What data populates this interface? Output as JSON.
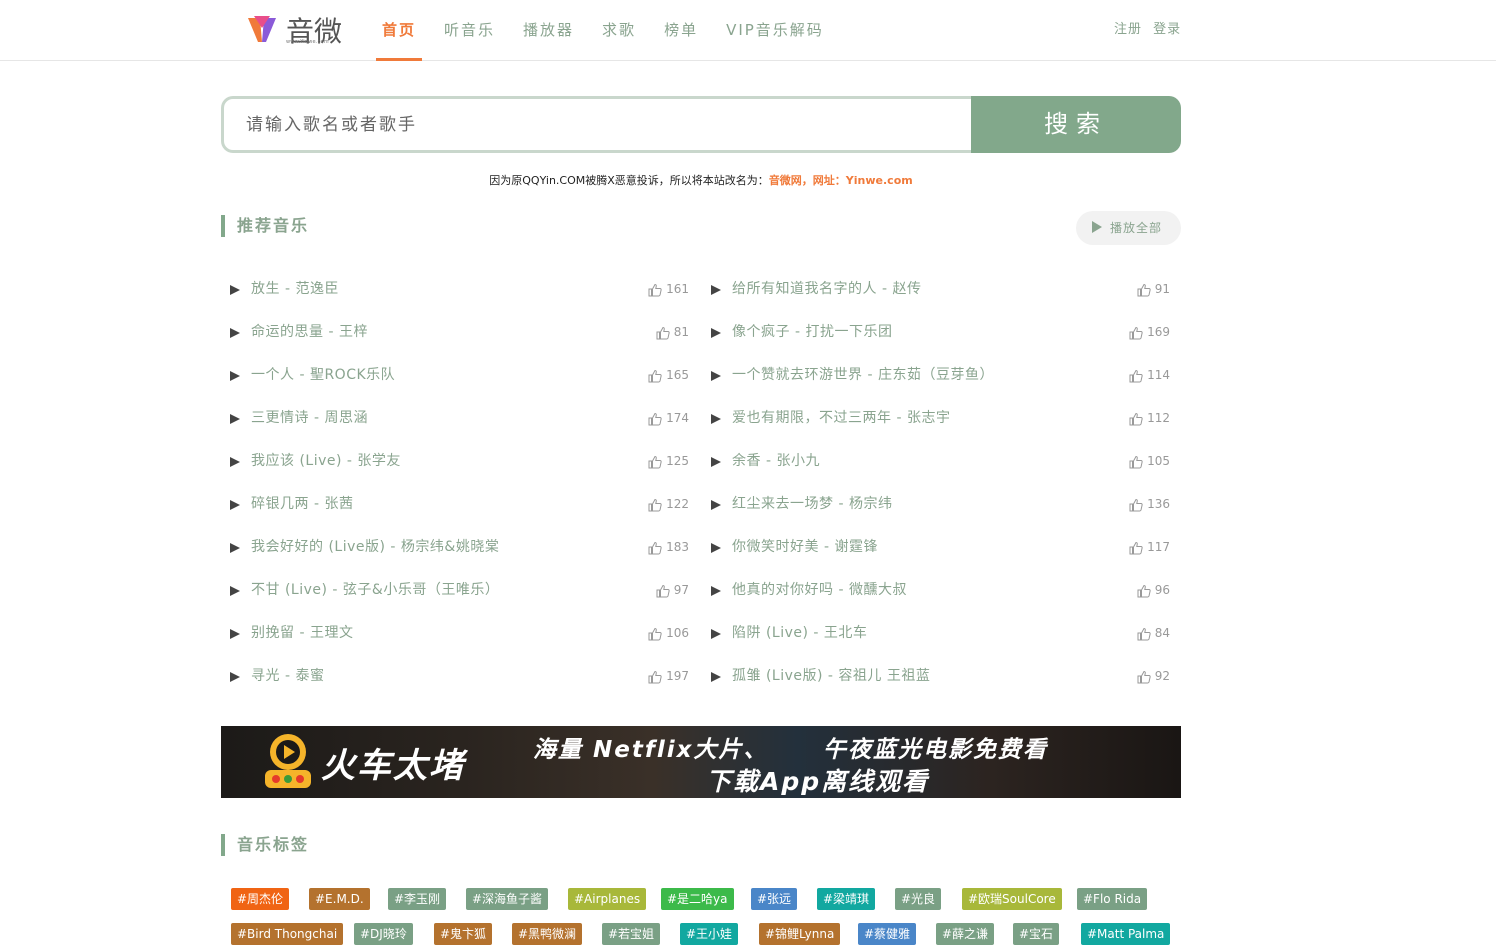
{
  "header": {
    "logo_text": "音微",
    "logo_sub": "www.Yinwe.com",
    "nav": [
      "首页",
      "听音乐",
      "播放器",
      "求歌",
      "榜单",
      "VIP音乐解码"
    ],
    "register": "注册",
    "login": "登录"
  },
  "search": {
    "placeholder": "请输入歌名或者歌手",
    "button": "搜索"
  },
  "notice": {
    "text": "因为原QQYin.COM被腾X恶意投诉，所以将本站改名为：",
    "highlight": "音微网，网址：Yinwe.com"
  },
  "recommend": {
    "title": "推荐音乐",
    "play_all": "播放全部",
    "left": [
      {
        "name": "放生 - 范逸臣",
        "likes": "161"
      },
      {
        "name": "命运的思量 - 王梓",
        "likes": "81"
      },
      {
        "name": "一个人 - 聖ROCK乐队",
        "likes": "165"
      },
      {
        "name": "三更情诗 - 周思涵",
        "likes": "174"
      },
      {
        "name": "我应该 (Live) - 张学友",
        "likes": "125"
      },
      {
        "name": "碎银几两 - 张茜",
        "likes": "122"
      },
      {
        "name": "我会好好的 (Live版) - 杨宗纬&姚晓棠",
        "likes": "183"
      },
      {
        "name": "不甘 (Live) - 弦子&小乐哥（王唯乐）",
        "likes": "97"
      },
      {
        "name": "别挽留 - 王理文",
        "likes": "106"
      },
      {
        "name": "寻光 - 泰蜜",
        "likes": "197"
      }
    ],
    "right": [
      {
        "name": "给所有知道我名字的人 - 赵传",
        "likes": "91"
      },
      {
        "name": "像个疯子 - 打扰一下乐团",
        "likes": "169"
      },
      {
        "name": "一个赞就去环游世界 - 庄东茹（豆芽鱼）",
        "likes": "114"
      },
      {
        "name": "爱也有期限，不过三两年 - 张志宇",
        "likes": "112"
      },
      {
        "name": "余香 - 张小九",
        "likes": "105"
      },
      {
        "name": "红尘来去一场梦 - 杨宗纬",
        "likes": "136"
      },
      {
        "name": "你微笑时好美 - 谢霆锋",
        "likes": "117"
      },
      {
        "name": "他真的对你好吗 - 微醺大叔",
        "likes": "96"
      },
      {
        "name": "陷阱 (Live) - 王北车",
        "likes": "84"
      },
      {
        "name": "孤雏 (Live版) - 容祖儿 王祖蓝",
        "likes": "92"
      }
    ]
  },
  "banner": {
    "brand": "火车太堵",
    "line1a": "海量 Netflix大片、",
    "line1b": "午夜蓝光电影免费看",
    "line2": "下载App离线观看"
  },
  "tags_section": {
    "title": "音乐标签",
    "row1": [
      {
        "label": "#周杰伦",
        "color": "#f06414"
      },
      {
        "label": "#E.M.D.",
        "color": "#b4722e"
      },
      {
        "label": "#李玉刚",
        "color": "#7aa085"
      },
      {
        "label": "#深海鱼子酱",
        "color": "#7aa085"
      },
      {
        "label": "#Airplanes",
        "color": "#a8b83a"
      },
      {
        "label": "#是二哈ya",
        "color": "#3cba4a"
      },
      {
        "label": "#张远",
        "color": "#4a86c8"
      },
      {
        "label": "#梁靖琪",
        "color": "#12a8a0"
      },
      {
        "label": "#光良",
        "color": "#7aa085"
      },
      {
        "label": "#欧瑞SoulCore",
        "color": "#a8b83a"
      },
      {
        "label": "#Flo Rida",
        "color": "#7aa085"
      }
    ],
    "row2": [
      {
        "label": "#Bird Thongchai",
        "color": "#b4722e"
      },
      {
        "label": "#DJ晓玲",
        "color": "#7aa085"
      },
      {
        "label": "#鬼卞狐",
        "color": "#b4722e"
      },
      {
        "label": "#黑鸭微澜",
        "color": "#b4722e"
      },
      {
        "label": "#若宝姐",
        "color": "#7aa085"
      },
      {
        "label": "#王小娃",
        "color": "#12a8a0"
      },
      {
        "label": "#锦鲤Lynna",
        "color": "#b4722e"
      },
      {
        "label": "#蔡健雅",
        "color": "#4a86c8"
      },
      {
        "label": "#薛之谦",
        "color": "#7aa085"
      },
      {
        "label": "#宝石",
        "color": "#7aa085"
      },
      {
        "label": "#Matt Palma",
        "color": "#12a8a0"
      }
    ]
  }
}
